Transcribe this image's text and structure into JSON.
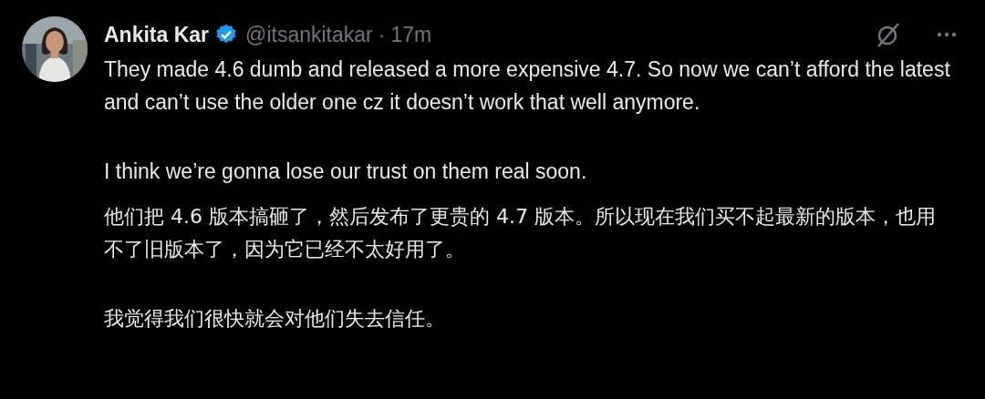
{
  "post": {
    "author_name": "Ankita Kar",
    "verified": true,
    "handle": "@itsankitakar",
    "separator": "·",
    "time": "17m",
    "paragraphs": [
      "They made 4.6 dumb and released a more expensive 4.7. So now we can’t afford the latest and can’t use the older one cz it doesn’t work that well anymore.",
      "I think we’re gonna lose our trust on them real soon.",
      "他们把 4.6 版本搞砸了，然后发布了更贵的 4.7 版本。所以现在我们买不起最新的版本，也用不了旧版本了，因为它已经不太好用了。",
      "我觉得我们很快就会对他们失去信任。"
    ]
  }
}
